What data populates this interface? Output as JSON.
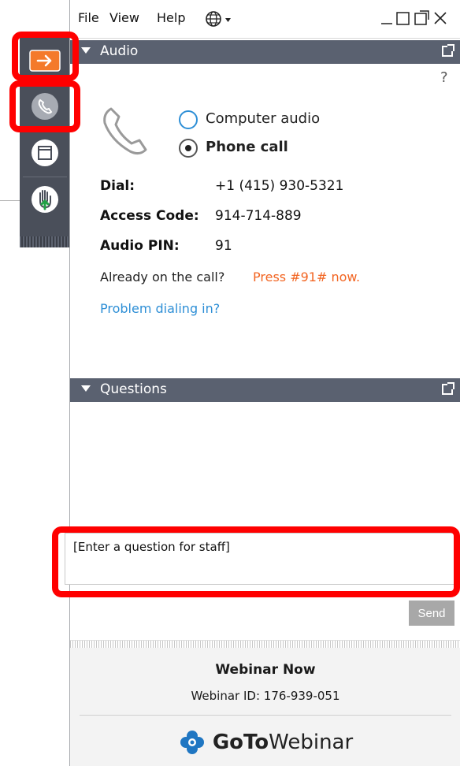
{
  "menu": {
    "file": "File",
    "view": "View",
    "help": "Help"
  },
  "audio": {
    "header": "Audio",
    "help_mark": "?",
    "options": [
      {
        "label": "Computer audio",
        "selected": false
      },
      {
        "label": "Phone call",
        "selected": true
      }
    ],
    "dial_label": "Dial:",
    "dial_value": "+1 (415) 930-5321",
    "access_label": "Access Code:",
    "access_value": "914-714-889",
    "pin_label": "Audio PIN:",
    "pin_value": "91",
    "already_text": "Already on the call?",
    "press_text": "Press #91# now.",
    "problem_link": "Problem dialing in?"
  },
  "questions": {
    "header": "Questions",
    "input_value": "[Enter a question for staff]",
    "send_label": "Send"
  },
  "footer": {
    "title": "Webinar Now",
    "webinar_id": "Webinar ID: 176-939-051",
    "logo_bold": "GoTo",
    "logo_regular": "Webinar"
  },
  "colors": {
    "header_bg": "#5a6170",
    "dock_bg": "#4a4f5a",
    "accent_orange": "#f26522",
    "link_blue": "#2e8fd6",
    "annotation_red": "#ff0000"
  },
  "icons": [
    "arrow-right-icon",
    "phone-icon",
    "window-icon",
    "raise-hand-icon",
    "globe-icon",
    "phone-handset-icon",
    "gotowebinar-logo-icon"
  ]
}
